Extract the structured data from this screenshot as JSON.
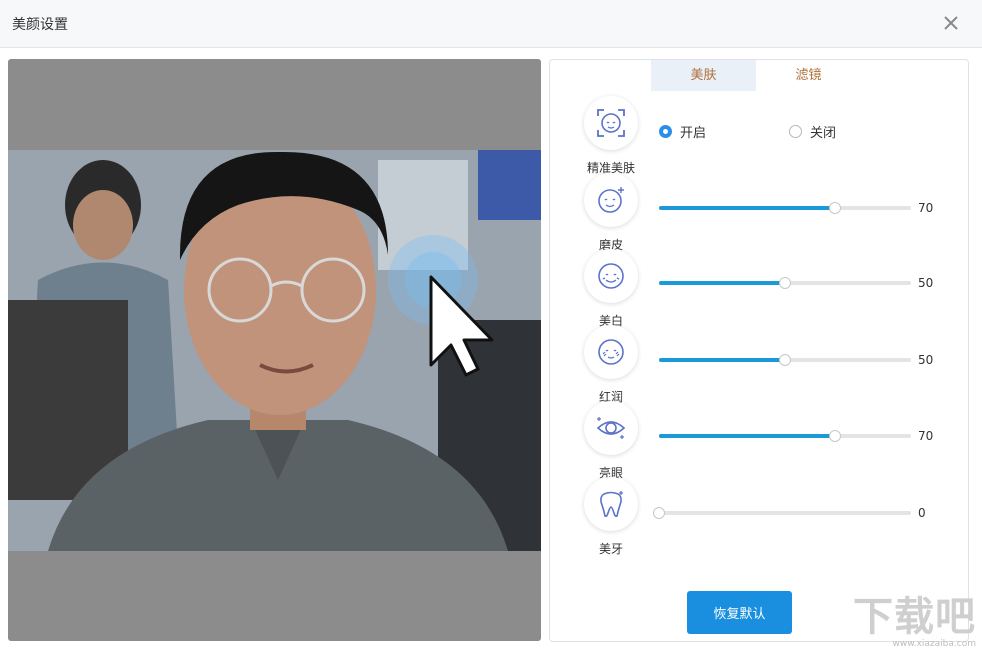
{
  "window": {
    "title": "美颜设置",
    "close_icon": "close-icon"
  },
  "tabs": [
    {
      "label": "美肤",
      "active": true
    },
    {
      "label": "滤镜",
      "active": false
    }
  ],
  "features": [
    {
      "label": "精准美肤",
      "icon": "face-frame-icon"
    },
    {
      "label": "磨皮",
      "icon": "face-sparkle-icon"
    },
    {
      "label": "美白",
      "icon": "face-smile-icon"
    },
    {
      "label": "红润",
      "icon": "face-blush-icon"
    },
    {
      "label": "亮眼",
      "icon": "eye-icon"
    },
    {
      "label": "美牙",
      "icon": "tooth-icon"
    }
  ],
  "precise": {
    "on_label": "开启",
    "off_label": "关闭",
    "selected": "on"
  },
  "sliders": [
    {
      "name": "磨皮",
      "value": 70,
      "display": "70"
    },
    {
      "name": "美白",
      "value": 50,
      "display": "50"
    },
    {
      "name": "红润",
      "value": 50,
      "display": "50"
    },
    {
      "name": "亮眼",
      "value": 70,
      "display": "70"
    },
    {
      "name": "美牙",
      "value": 0,
      "display": "0"
    }
  ],
  "reset_label": "恢复默认",
  "watermark": {
    "brand": "下载吧",
    "url": "www.xiazaiba.com"
  },
  "colors": {
    "accent": "#1a8fe0",
    "slider_fill": "#1a9ad8",
    "tab_text": "#b0703a",
    "tab_active_bg": "#e9f0f8"
  }
}
